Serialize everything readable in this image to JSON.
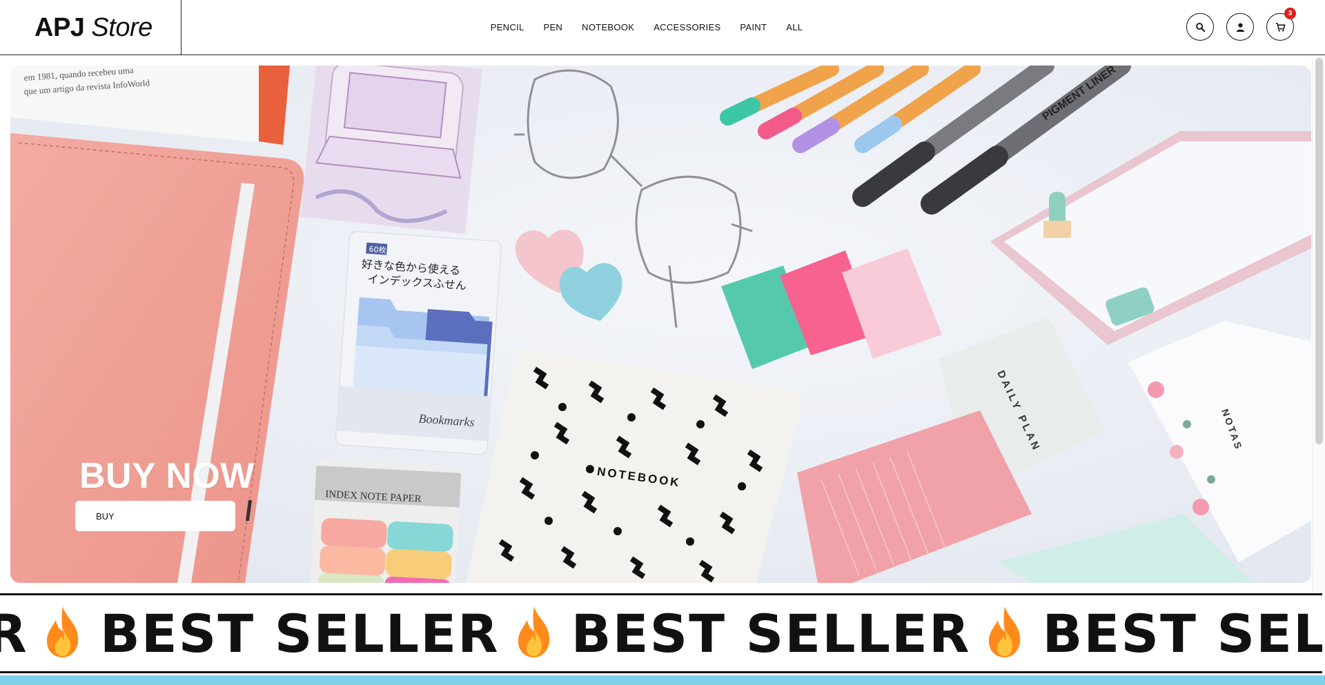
{
  "brand": {
    "strong": "APJ",
    "light": "Store"
  },
  "nav": {
    "items": [
      {
        "label": "PENCIL"
      },
      {
        "label": "PEN"
      },
      {
        "label": "NOTEBOOK"
      },
      {
        "label": "ACCESSORIES"
      },
      {
        "label": "PAINT"
      },
      {
        "label": "ALL"
      }
    ]
  },
  "actions": {
    "search_icon": "search-icon",
    "account_icon": "user-icon",
    "cart_icon": "cart-icon",
    "cart_count": "3"
  },
  "hero": {
    "title": "BUY NOW",
    "button_label": "BUY",
    "scene_texts": {
      "notebook": "NOTEBOOK",
      "daily_plan": "DAILY PLAN",
      "notas": "NOTAS",
      "bookmarks": "Bookmarks",
      "index_note": "INDEX NOTE PAPER",
      "pigment_liner": "PIGMENT LINER",
      "jp_line1": "好きな色から使える",
      "jp_line2": "インデックスふせん",
      "badge": "60枚"
    }
  },
  "marquee": {
    "text": "BEST SELLER",
    "repeat": 4,
    "flame_icon": "fire-icon"
  },
  "colors": {
    "accent_red": "#e0201a",
    "pink_notebook": "#f1a39a",
    "mint": "#56c9ad",
    "hot_pink": "#f7628f",
    "strip_blue": "#7fd0e8"
  }
}
